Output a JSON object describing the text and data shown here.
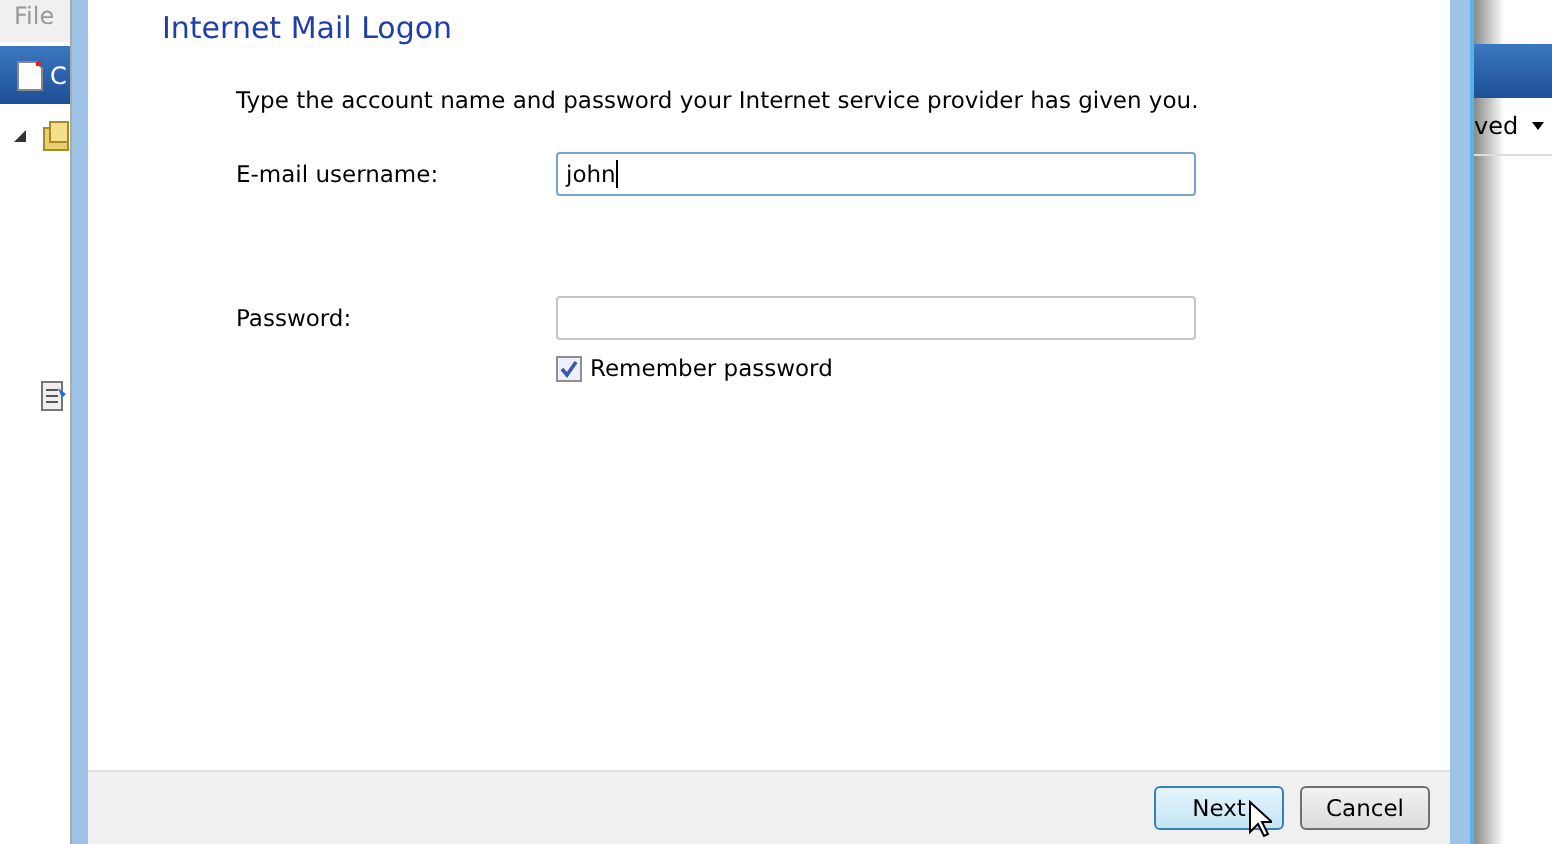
{
  "background_window": {
    "menu": "File",
    "toolbar_text": "C",
    "column_header": "ved"
  },
  "dialog": {
    "title": "Internet Mail Logon",
    "instruction": "Type the account name and password your Internet service provider has given you.",
    "fields": [
      {
        "label": "E-mail username:",
        "value": "john",
        "focused": true
      },
      {
        "label": "Password:",
        "focused": false
      }
    ],
    "remember_password": {
      "label": "Remember password",
      "checked": true
    },
    "buttons": [
      {
        "label": "Next",
        "default": true
      },
      {
        "label": "Cancel",
        "default": false
      }
    ]
  }
}
